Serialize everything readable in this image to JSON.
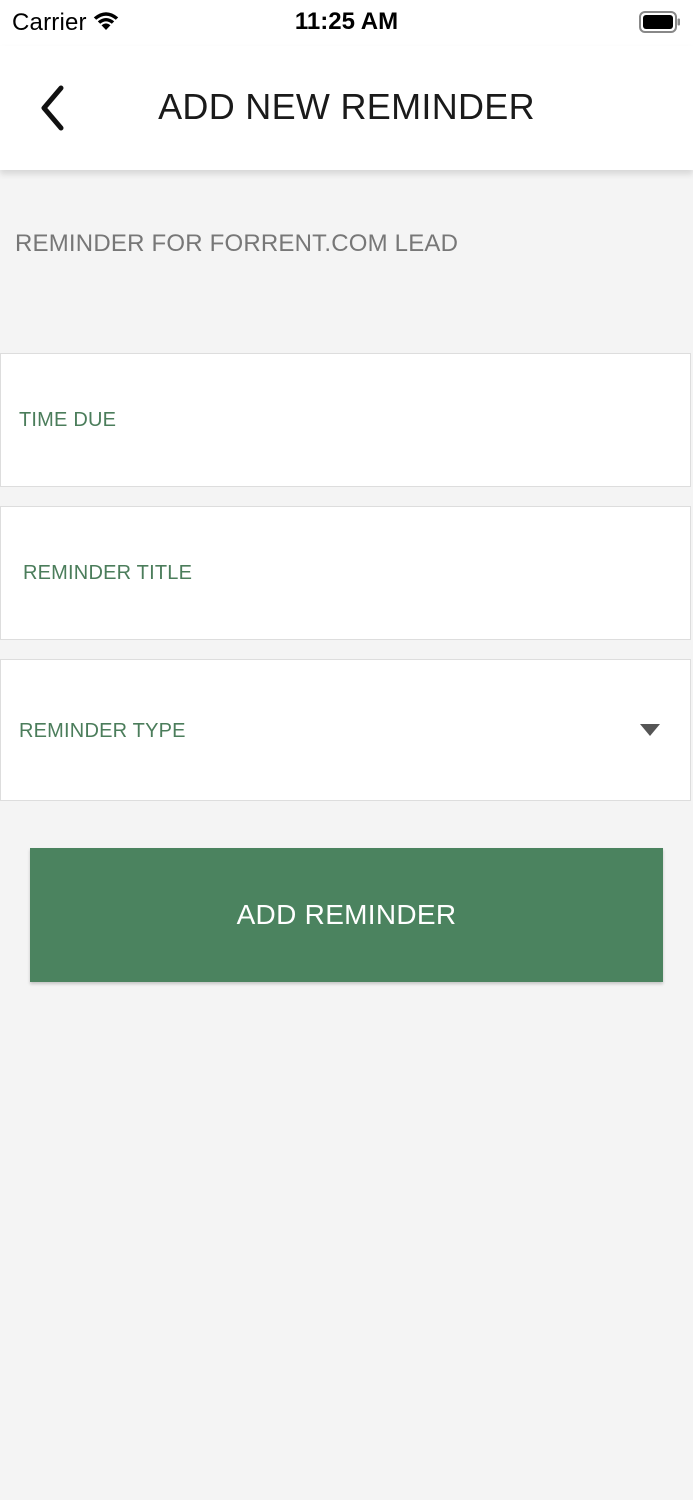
{
  "status_bar": {
    "carrier": "Carrier",
    "time": "11:25 AM"
  },
  "header": {
    "title": "ADD NEW REMINDER"
  },
  "subtitle": "REMINDER FOR FORRENT.COM LEAD",
  "form": {
    "time_due_label": "TIME DUE",
    "reminder_title_label": "REMINDER TITLE",
    "reminder_type_label": "REMINDER TYPE"
  },
  "actions": {
    "add_reminder_label": "ADD REMINDER"
  },
  "icons": {
    "back": "chevron-left-icon",
    "wifi": "wifi-icon",
    "battery": "battery-icon",
    "dropdown": "caret-down-icon"
  },
  "colors": {
    "accent": "#4b835f",
    "label": "#4b7d5b",
    "background": "#f4f4f4"
  }
}
